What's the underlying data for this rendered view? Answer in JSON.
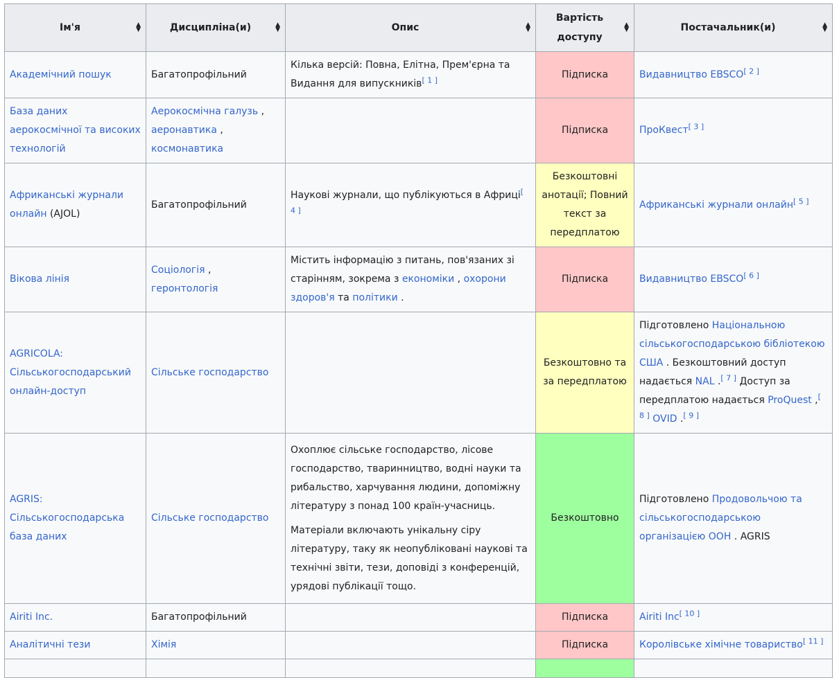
{
  "headers": [
    "Ім'я",
    "Дисципліна(и)",
    "Опис",
    "Вартість доступу",
    "Постачальник(и)"
  ],
  "rows": [
    {
      "name": "Академічний пошук",
      "name_suffix": "",
      "discipline": [
        {
          "text": "Багатопрофільний",
          "link": false
        }
      ],
      "desc_parts": [
        {
          "text": "Кілька версій: Повна, Елітна, Прем'єрна та Видання для випускників",
          "link": false
        },
        {
          "text": "[ 1 ]",
          "sup": true
        }
      ],
      "cost": "Підписка",
      "cost_color": "red",
      "provider_parts": [
        {
          "text": "Видавництво EBSCO",
          "link": true
        },
        {
          "text": "[ 2 ]",
          "sup": true
        }
      ]
    },
    {
      "name": "База даних аерокосмічної та високих технологій",
      "name_suffix": "",
      "discipline": [
        {
          "text": "Аерокосмічна галузь",
          "link": true
        },
        {
          "text": " , ",
          "link": false
        },
        {
          "text": "аеронавтика",
          "link": true
        },
        {
          "text": " , ",
          "link": false
        },
        {
          "text": "космонавтика",
          "link": true
        }
      ],
      "desc_parts": [],
      "cost": "Підписка",
      "cost_color": "red",
      "provider_parts": [
        {
          "text": "ПроКвест",
          "link": true
        },
        {
          "text": "[ 3 ]",
          "sup": true
        }
      ]
    },
    {
      "name": "Африканські журнали онлайн",
      "name_suffix": " (AJOL)",
      "discipline": [
        {
          "text": "Багатопрофільний",
          "link": false
        }
      ],
      "desc_parts": [
        {
          "text": "Наукові журнали, що публікуються в Африці",
          "link": false
        },
        {
          "text": "[ 4 ]",
          "sup": true
        }
      ],
      "cost": "Безкоштовні анотації; Повний текст за передплатою",
      "cost_color": "yellow",
      "provider_parts": [
        {
          "text": "Африканські журнали онлайн",
          "link": true
        },
        {
          "text": "[ 5 ]",
          "sup": true
        }
      ]
    },
    {
      "name": "Вікова лінія",
      "name_suffix": "",
      "discipline": [
        {
          "text": "Соціологія",
          "link": true
        },
        {
          "text": " , ",
          "link": false
        },
        {
          "text": "геронтологія",
          "link": true
        }
      ],
      "desc_parts": [
        {
          "text": "Містить інформацію з питань, пов'язаних зі старінням, зокрема з ",
          "link": false
        },
        {
          "text": "економіки",
          "link": true
        },
        {
          "text": " , ",
          "link": false
        },
        {
          "text": "охорони здоров'я",
          "link": true
        },
        {
          "text": " та ",
          "link": false
        },
        {
          "text": "політики",
          "link": true
        },
        {
          "text": " .",
          "link": false
        }
      ],
      "cost": "Підписка",
      "cost_color": "red",
      "provider_parts": [
        {
          "text": "Видавництво EBSCO",
          "link": true
        },
        {
          "text": "[ 6 ]",
          "sup": true
        }
      ]
    },
    {
      "name": "AGRICOLA: Сільськогосподарський онлайн-доступ",
      "name_suffix": "",
      "discipline": [
        {
          "text": "Сільське господарство",
          "link": true
        }
      ],
      "desc_parts": [],
      "cost": "Безкоштовно та за передплатою",
      "cost_color": "yellow",
      "provider_parts": [
        {
          "text": "Підготовлено ",
          "link": false
        },
        {
          "text": "Національною сільськогосподарською бібліотекою США",
          "link": true
        },
        {
          "text": " . Безкоштовний доступ надається ",
          "link": false
        },
        {
          "text": "NAL",
          "link": true
        },
        {
          "text": " .",
          "link": false
        },
        {
          "text": "[ 7 ]",
          "sup": true
        },
        {
          "text": " Доступ за передплатою надається ",
          "link": false
        },
        {
          "text": "ProQuest",
          "link": true
        },
        {
          "text": " ,",
          "link": false
        },
        {
          "text": "[ 8 ]",
          "sup": true
        },
        {
          "text": " ",
          "link": false
        },
        {
          "text": "OVID",
          "link": true
        },
        {
          "text": " .",
          "link": false
        },
        {
          "text": "[ 9 ]",
          "sup": true
        }
      ]
    },
    {
      "name": "AGRIS: Сільськогосподарська база даних",
      "name_suffix": "",
      "discipline": [
        {
          "text": "Сільське господарство",
          "link": true
        }
      ],
      "desc_paragraphs": [
        "Охоплює сільське господарство, лісове господарство, тваринництво, водні науки та рибальство, харчування людини, допоміжну літературу з понад 100 країн-учасниць.",
        "Матеріали включають унікальну сіру літературу, таку як неопубліковані наукові та технічні звіти, тези, доповіді з конференцій, урядові публікації тощо."
      ],
      "cost": "Безкоштовно",
      "cost_color": "green",
      "provider_parts": [
        {
          "text": "Підготовлено ",
          "link": false
        },
        {
          "text": "Продовольчою та сільськогосподарською організацією ООН",
          "link": true
        },
        {
          "text": " . AGRIS",
          "link": false
        }
      ]
    },
    {
      "name": "Airiti Inc.",
      "name_suffix": "",
      "discipline": [
        {
          "text": "Багатопрофільний",
          "link": false
        }
      ],
      "desc_parts": [],
      "cost": "Підписка",
      "cost_color": "red",
      "provider_parts": [
        {
          "text": "Airiti Inc",
          "link": true
        },
        {
          "text": "[ 10 ]",
          "sup": true
        }
      ]
    },
    {
      "name": "Аналітичні тези",
      "name_suffix": "",
      "discipline": [
        {
          "text": "Хімія",
          "link": true
        }
      ],
      "desc_parts": [],
      "cost": "Підписка",
      "cost_color": "red",
      "provider_parts": [
        {
          "text": "Королівське хімічне товариство",
          "link": true
        },
        {
          "text": "[ 11 ]",
          "sup": true
        }
      ]
    },
    {
      "name": "",
      "name_suffix": "",
      "discipline": [],
      "desc_parts": [],
      "cost": "",
      "cost_color": "green",
      "provider_parts": []
    }
  ]
}
